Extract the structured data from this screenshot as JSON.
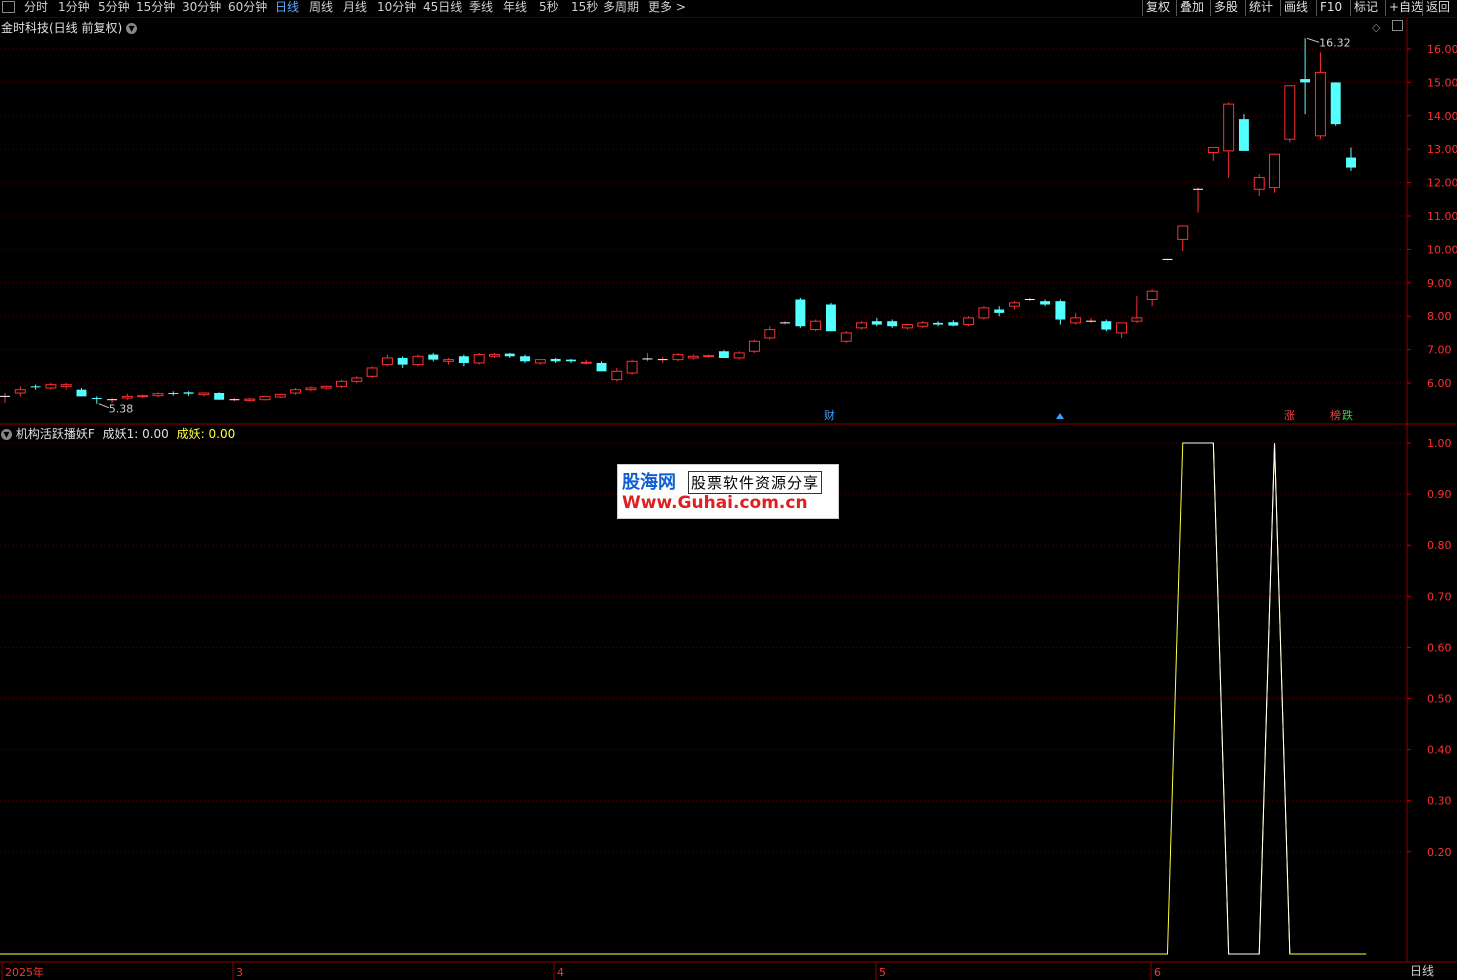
{
  "toolbar": {
    "periods": [
      "分时",
      "1分钟",
      "5分钟",
      "15分钟",
      "30分钟",
      "60分钟",
      "日线",
      "周线",
      "月线",
      "10分钟",
      "45日线",
      "季线",
      "年线",
      "5秒",
      "15秒",
      "多周期",
      "更多 >"
    ],
    "active_period": "日线",
    "right_buttons": [
      "复权",
      "叠加",
      "多股",
      "统计",
      "画线",
      "F10",
      "标记",
      "+自选",
      "返回"
    ]
  },
  "main_panel": {
    "title": "金时科技(日线 前复权)",
    "high_label": "16.32",
    "low_label": "5.38",
    "markers": [
      {
        "text": "财",
        "color": "#3aa0ff"
      },
      {
        "text": "涨",
        "color": "#ff4040"
      },
      {
        "text": "榜",
        "color": "#ff4040"
      },
      {
        "text": "跌",
        "color": "#40d040"
      }
    ]
  },
  "indicator_panel": {
    "name": "机构活跃播妖F",
    "field1_label": "成妖1:",
    "field1_value": "0.00",
    "field2_label": "成妖:",
    "field2_value": "0.00"
  },
  "watermark": {
    "brand": "股海网",
    "subtitle": "股票软件资源分享",
    "url": "Www.Guhai.com.cn"
  },
  "x_axis": {
    "labels": [
      "2025年",
      "3",
      "4",
      "5",
      "6"
    ]
  },
  "bottom_tab": "日线",
  "chart_data": [
    {
      "type": "candlestick",
      "ylim": [
        5.0,
        16.6
      ],
      "y_ticks": [
        6.0,
        7.0,
        8.0,
        9.0,
        10.0,
        11.0,
        12.0,
        13.0,
        14.0,
        15.0,
        16.0
      ],
      "candles": [
        [
          5.6,
          5.7,
          5.4,
          5.6
        ],
        [
          5.7,
          5.9,
          5.6,
          5.8
        ],
        [
          5.9,
          5.95,
          5.8,
          5.88
        ],
        [
          5.85,
          6.0,
          5.8,
          5.95
        ],
        [
          5.9,
          6.0,
          5.8,
          5.95
        ],
        [
          5.8,
          5.85,
          5.6,
          5.6
        ],
        [
          5.55,
          5.6,
          5.38,
          5.52
        ],
        [
          5.5,
          5.55,
          5.4,
          5.5
        ],
        [
          5.55,
          5.68,
          5.5,
          5.6
        ],
        [
          5.6,
          5.65,
          5.55,
          5.62
        ],
        [
          5.62,
          5.72,
          5.58,
          5.68
        ],
        [
          5.7,
          5.75,
          5.62,
          5.68
        ],
        [
          5.72,
          5.75,
          5.62,
          5.68
        ],
        [
          5.65,
          5.72,
          5.6,
          5.7
        ],
        [
          5.7,
          5.72,
          5.5,
          5.5
        ],
        [
          5.5,
          5.55,
          5.45,
          5.5
        ],
        [
          5.48,
          5.55,
          5.45,
          5.52
        ],
        [
          5.5,
          5.62,
          5.48,
          5.6
        ],
        [
          5.58,
          5.68,
          5.55,
          5.66
        ],
        [
          5.7,
          5.85,
          5.65,
          5.8
        ],
        [
          5.8,
          5.9,
          5.75,
          5.85
        ],
        [
          5.85,
          5.92,
          5.8,
          5.9
        ],
        [
          5.9,
          6.1,
          5.85,
          6.05
        ],
        [
          6.05,
          6.2,
          6.0,
          6.15
        ],
        [
          6.2,
          6.5,
          6.15,
          6.45
        ],
        [
          6.55,
          6.85,
          6.5,
          6.75
        ],
        [
          6.75,
          6.8,
          6.45,
          6.55
        ],
        [
          6.55,
          6.85,
          6.5,
          6.8
        ],
        [
          6.85,
          6.9,
          6.65,
          6.7
        ],
        [
          6.65,
          6.75,
          6.55,
          6.7
        ],
        [
          6.8,
          6.85,
          6.5,
          6.6
        ],
        [
          6.6,
          6.9,
          6.55,
          6.85
        ],
        [
          6.8,
          6.9,
          6.75,
          6.85
        ],
        [
          6.88,
          6.9,
          6.75,
          6.8
        ],
        [
          6.8,
          6.85,
          6.6,
          6.65
        ],
        [
          6.6,
          6.7,
          6.55,
          6.7
        ],
        [
          6.72,
          6.75,
          6.6,
          6.65
        ],
        [
          6.7,
          6.72,
          6.6,
          6.65
        ],
        [
          6.6,
          6.7,
          6.55,
          6.62
        ],
        [
          6.6,
          6.65,
          6.35,
          6.35
        ],
        [
          6.1,
          6.45,
          6.05,
          6.35
        ],
        [
          6.3,
          6.7,
          6.25,
          6.65
        ],
        [
          6.7,
          6.9,
          6.65,
          6.72
        ],
        [
          6.7,
          6.78,
          6.6,
          6.7
        ],
        [
          6.7,
          6.9,
          6.65,
          6.85
        ],
        [
          6.75,
          6.85,
          6.7,
          6.8
        ],
        [
          6.8,
          6.85,
          6.75,
          6.82
        ],
        [
          6.95,
          6.98,
          6.75,
          6.75
        ],
        [
          6.75,
          6.95,
          6.7,
          6.9
        ],
        [
          6.95,
          7.3,
          6.9,
          7.25
        ],
        [
          7.35,
          7.7,
          7.3,
          7.6
        ],
        [
          7.8,
          7.85,
          7.75,
          7.8
        ],
        [
          8.5,
          8.55,
          7.65,
          7.7
        ],
        [
          7.6,
          7.9,
          7.55,
          7.85
        ],
        [
          8.35,
          8.4,
          7.55,
          7.55
        ],
        [
          7.25,
          7.55,
          7.2,
          7.5
        ],
        [
          7.65,
          7.85,
          7.6,
          7.8
        ],
        [
          7.85,
          7.95,
          7.7,
          7.75
        ],
        [
          7.85,
          7.9,
          7.65,
          7.7
        ],
        [
          7.65,
          7.78,
          7.6,
          7.75
        ],
        [
          7.7,
          7.85,
          7.65,
          7.8
        ],
        [
          7.8,
          7.85,
          7.7,
          7.75
        ],
        [
          7.82,
          7.88,
          7.7,
          7.72
        ],
        [
          7.75,
          8.0,
          7.7,
          7.95
        ],
        [
          7.95,
          8.3,
          7.9,
          8.25
        ],
        [
          8.2,
          8.3,
          8.0,
          8.1
        ],
        [
          8.3,
          8.45,
          8.2,
          8.4
        ],
        [
          8.5,
          8.55,
          8.45,
          8.5
        ],
        [
          8.45,
          8.5,
          8.3,
          8.35
        ],
        [
          8.45,
          8.5,
          7.75,
          7.9
        ],
        [
          7.8,
          8.1,
          7.75,
          7.95
        ],
        [
          7.85,
          7.95,
          7.8,
          7.85
        ],
        [
          7.85,
          7.9,
          7.55,
          7.6
        ],
        [
          7.5,
          7.8,
          7.35,
          7.8
        ],
        [
          7.85,
          8.6,
          7.8,
          7.95
        ],
        [
          8.5,
          8.8,
          8.3,
          8.75
        ],
        [
          9.7,
          9.72,
          9.68,
          9.7
        ],
        [
          10.3,
          10.7,
          9.95,
          10.7
        ],
        [
          11.8,
          11.85,
          11.1,
          11.8
        ],
        [
          12.9,
          13.05,
          12.65,
          13.05
        ],
        [
          12.95,
          14.4,
          12.15,
          14.35
        ],
        [
          13.9,
          14.05,
          12.95,
          12.95
        ],
        [
          11.8,
          12.25,
          11.6,
          12.15
        ],
        [
          11.85,
          12.85,
          11.7,
          12.85
        ],
        [
          13.3,
          14.9,
          13.2,
          14.9
        ],
        [
          15.1,
          16.32,
          14.05,
          15.0
        ],
        [
          13.4,
          15.9,
          13.3,
          15.3
        ],
        [
          15.0,
          15.0,
          13.7,
          13.75
        ],
        [
          12.75,
          13.05,
          12.35,
          12.45
        ]
      ]
    },
    {
      "type": "line",
      "ylim": [
        0.0,
        1.05
      ],
      "y_ticks": [
        0.2,
        0.3,
        0.4,
        0.5,
        0.6,
        0.7,
        0.8,
        0.9,
        1.0
      ],
      "series": [
        {
          "color": "#ffff40",
          "points": [
            [
              0,
              0
            ],
            [
              76,
              0
            ],
            [
              77,
              1
            ],
            [
              79,
              1
            ],
            [
              80,
              0
            ],
            [
              82,
              0
            ],
            [
              83,
              1
            ],
            [
              84,
              0
            ],
            [
              89,
              0
            ]
          ]
        },
        {
          "color": "#ffffff",
          "points": [
            [
              77,
              1
            ],
            [
              79,
              1
            ],
            [
              80,
              0
            ],
            [
              81,
              0
            ],
            [
              82,
              0
            ],
            [
              83,
              1
            ],
            [
              84,
              0
            ]
          ]
        }
      ]
    }
  ]
}
